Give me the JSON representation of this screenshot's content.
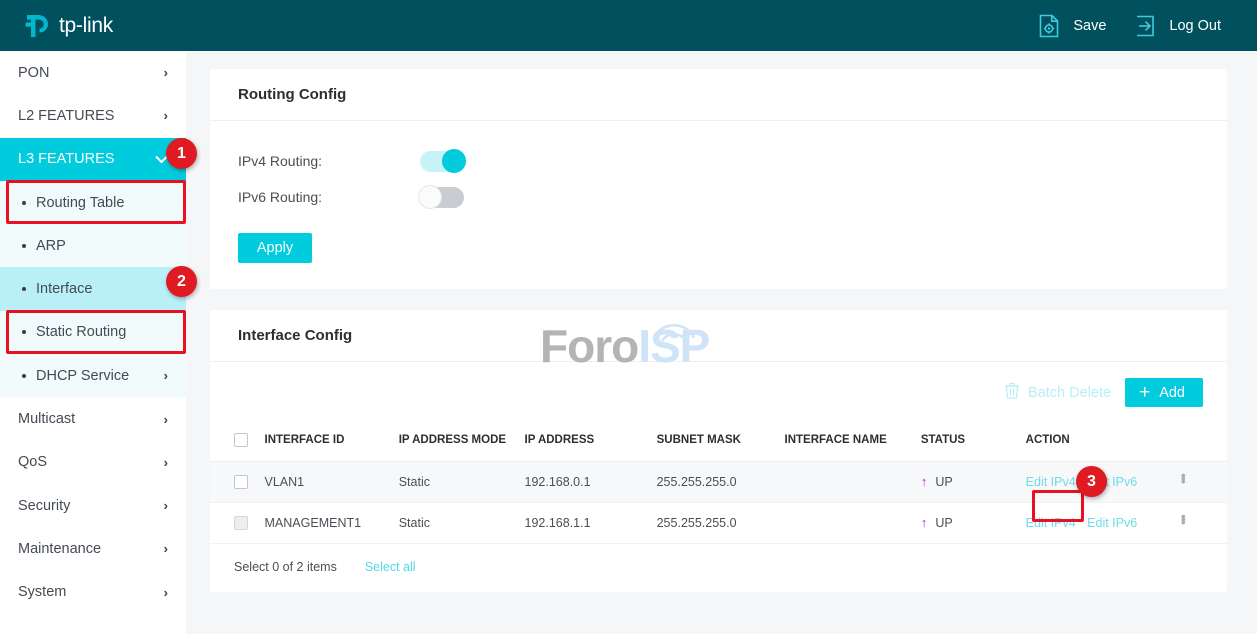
{
  "header": {
    "brand": "tp-link",
    "actions": [
      {
        "label": "Save",
        "icon": "save-gear-icon"
      },
      {
        "label": "Log Out",
        "icon": "logout-arrow-icon"
      }
    ]
  },
  "sidebar": {
    "items": [
      {
        "label": "PON",
        "chevron": "›",
        "state": "collapsed"
      },
      {
        "label": "L2 FEATURES",
        "chevron": "›",
        "state": "collapsed"
      },
      {
        "label": "L3 FEATURES",
        "chevron": "⌄",
        "state": "expanded-active"
      }
    ],
    "sub_items": [
      {
        "label": "Routing Table",
        "chevron": ""
      },
      {
        "label": "ARP",
        "chevron": ""
      },
      {
        "label": "Interface",
        "chevron": "",
        "state": "selected"
      },
      {
        "label": "Static Routing",
        "chevron": ""
      },
      {
        "label": "DHCP Service",
        "chevron": "›"
      }
    ],
    "items_after": [
      {
        "label": "Multicast",
        "chevron": "›"
      },
      {
        "label": "QoS",
        "chevron": "›"
      },
      {
        "label": "Security",
        "chevron": "›"
      },
      {
        "label": "Maintenance",
        "chevron": "›"
      },
      {
        "label": "System",
        "chevron": "›"
      }
    ]
  },
  "routing_config": {
    "title": "Routing Config",
    "ipv4_label": "IPv4 Routing:",
    "ipv4_state": "on",
    "ipv6_label": "IPv6 Routing:",
    "ipv6_state": "off",
    "apply_label": "Apply"
  },
  "interface_config": {
    "title": "Interface Config",
    "batch_delete_label": "Batch Delete",
    "batch_delete_enabled": false,
    "add_label": "Add",
    "add_plus": "+",
    "columns": [
      "INTERFACE ID",
      "IP ADDRESS MODE",
      "IP ADDRESS",
      "SUBNET MASK",
      "INTERFACE NAME",
      "STATUS",
      "ACTION"
    ],
    "rows": [
      {
        "interface_id": "VLAN1",
        "ip_address_mode": "Static",
        "ip_address": "192.168.0.1",
        "subnet_mask": "255.255.255.0",
        "interface_name": "",
        "status": "UP",
        "status_arrow": "↑",
        "action_ipv4": "Edit IPv4",
        "action_ipv6": "Edit IPv6"
      },
      {
        "interface_id": "MANAGEMENT1",
        "ip_address_mode": "Static",
        "ip_address": "192.168.1.1",
        "subnet_mask": "255.255.255.0",
        "interface_name": "",
        "status": "UP",
        "status_arrow": "↑",
        "action_ipv4": "Edit IPv4",
        "action_ipv6": "Edit IPv6"
      }
    ],
    "select_summary": "Select 0 of 2 items",
    "select_all_label": "Select all"
  },
  "watermark": {
    "part1": "Foro",
    "part2": "ISP"
  },
  "annotations": [
    {
      "badge": "1",
      "target": "l3-features-nav-item"
    },
    {
      "badge": "2",
      "target": "interface-sub-item"
    },
    {
      "badge": "3",
      "target": "edit-ipv4-link-row-2"
    }
  ],
  "colors": {
    "header_bg": "#00505e",
    "accent": "#00ccdd",
    "annotation_red": "#e01a22",
    "status_up": "#b122ee",
    "link": "#6fdbe8"
  }
}
